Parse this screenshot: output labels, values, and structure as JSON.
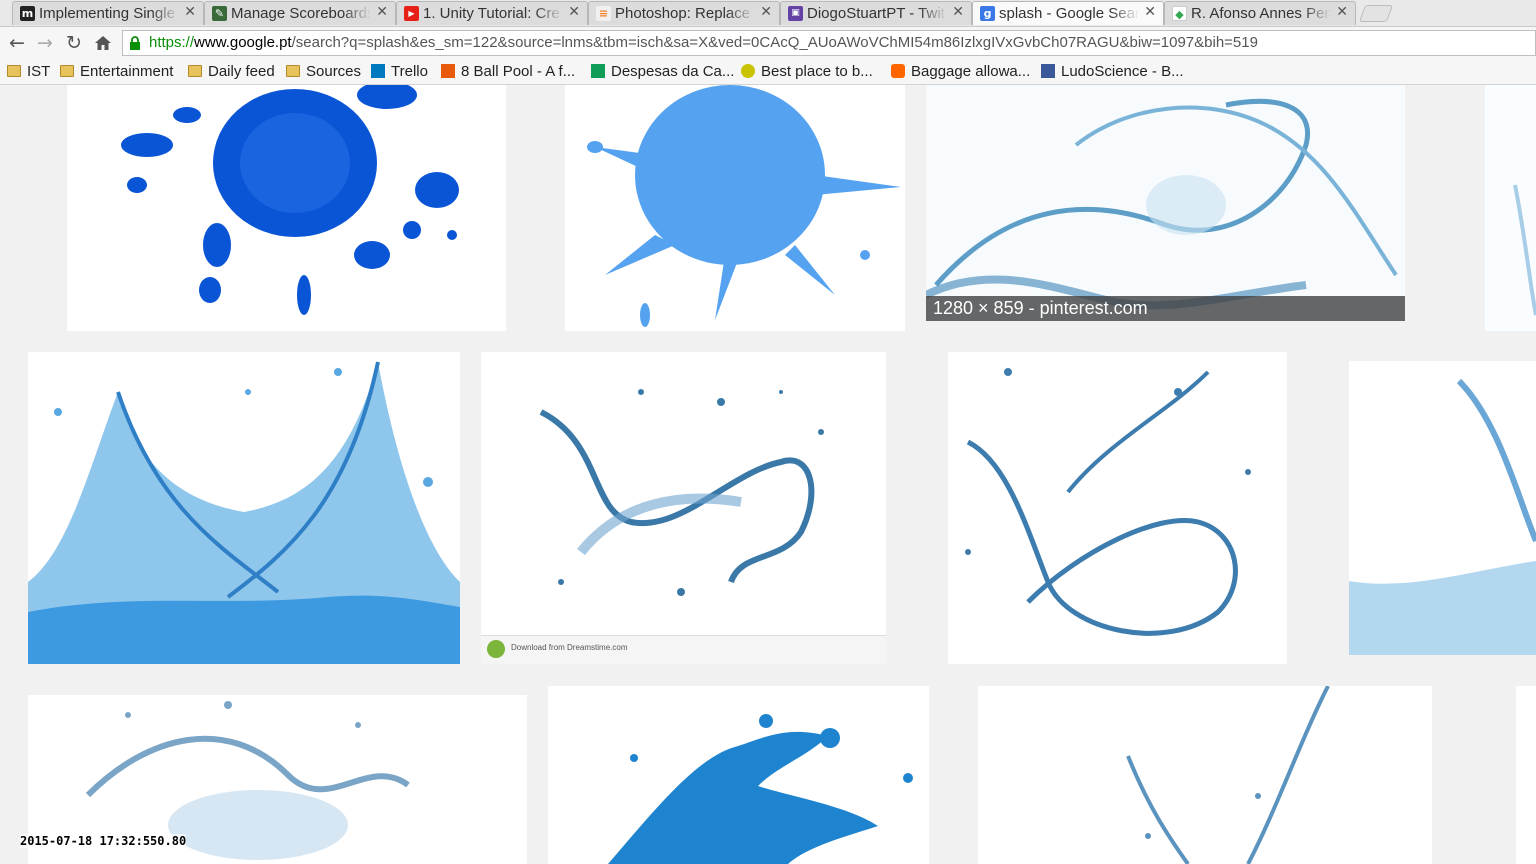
{
  "tabs": [
    {
      "title": "Implementing Single",
      "icon": "medium-icon",
      "color": "#222222",
      "glyph": "m"
    },
    {
      "title": "Manage Scoreboards",
      "icon": "scoreboard-icon",
      "color": "#3a6a3a",
      "glyph": "✎"
    },
    {
      "title": "1. Unity Tutorial: Cre",
      "icon": "youtube-icon",
      "color": "#e62117",
      "glyph": "▶"
    },
    {
      "title": "Photoshop: Replace",
      "icon": "stackexchange-icon",
      "color": "#f48024",
      "glyph": "≡"
    },
    {
      "title": "DiogoStuartPT - Twit",
      "icon": "twitch-icon",
      "color": "#6441a5",
      "glyph": "▣"
    },
    {
      "title": "splash - Google Sear",
      "icon": "google-icon",
      "color": "#3b78e7",
      "glyph": "g"
    },
    {
      "title": "R. Afonso Annes Pen",
      "icon": "maps-icon",
      "color": "#34a853",
      "glyph": "◆"
    }
  ],
  "active_tab": 5,
  "omnibox": {
    "scheme": "https://",
    "domain": "www.google.pt",
    "path": "/search?q=splash&es_sm=122&source=lnms&tbm=isch&sa=X&ved=0CAcQ_AUoAWoVChMI54m86IzlxgIVxGvbCh07RAGU&biw=1097&bih=519"
  },
  "bookmarks": [
    {
      "label": "IST",
      "icon": "folder-icon"
    },
    {
      "label": "Entertainment",
      "icon": "folder-icon"
    },
    {
      "label": "Daily feed",
      "icon": "folder-icon"
    },
    {
      "label": "Sources",
      "icon": "folder-icon"
    },
    {
      "label": "Trello",
      "icon": "trello-icon"
    },
    {
      "label": "8 Ball Pool - A f...",
      "icon": "miniclip-icon"
    },
    {
      "label": "Despesas da Ca...",
      "icon": "sheets-icon"
    },
    {
      "label": "Best place to b...",
      "icon": "smiley-icon"
    },
    {
      "label": "Baggage allowa...",
      "icon": "easyjet-icon"
    },
    {
      "label": "LudoScience - B...",
      "icon": "facebook-icon"
    }
  ],
  "results": {
    "hover_caption": "1280 × 859 - pinterest.com",
    "dreamstime_label": "Download from Dreamstime.com"
  },
  "timestamp": "2015-07-18 17:32:550.80"
}
